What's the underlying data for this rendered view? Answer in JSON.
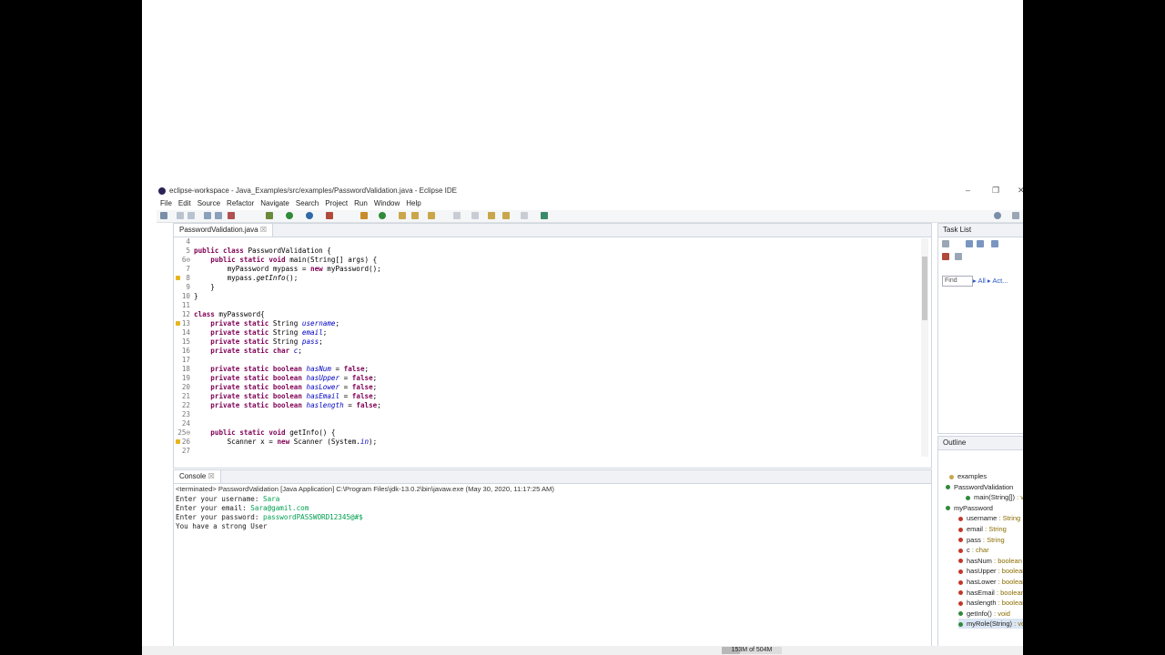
{
  "window": {
    "title": "eclipse-workspace - Java_Examples/src/examples/PasswordValidation.java - Eclipse IDE",
    "controls": [
      "–",
      "❐",
      "✕"
    ]
  },
  "menu": [
    "File",
    "Edit",
    "Source",
    "Refactor",
    "Navigate",
    "Search",
    "Project",
    "Run",
    "Window",
    "Help"
  ],
  "editor": {
    "tab_label": "PasswordValidation.java",
    "tab_close": "☒"
  },
  "console": {
    "tab_label": "Console",
    "tab_close": "☒",
    "status": "<terminated> PasswordValidation [Java Application] C:\\Program Files\\jdk-13.0.2\\bin\\javaw.exe (May 30, 2020, 11:17:25 AM)",
    "lines": [
      {
        "prompt": "Enter your username: ",
        "input": "Sara"
      },
      {
        "prompt": "Enter your email: ",
        "input": "Sara@gamil.com"
      },
      {
        "prompt": "Enter your password: ",
        "input": "passwordPASSWORD12345@#$"
      },
      {
        "prompt": "You have a strong User",
        "input": ""
      }
    ]
  },
  "tasklist": {
    "tab_label": "Task List",
    "find_placeholder": "Find",
    "link_all": "All",
    "link_activate": "Act..."
  },
  "outline": {
    "tab_label": "Outline",
    "items": [
      {
        "name": "examples",
        "type": ""
      },
      {
        "name": "PasswordValidation",
        "type": ""
      },
      {
        "name": "main(String[])",
        "type": " : void"
      },
      {
        "name": "myPassword",
        "type": ""
      },
      {
        "name": "username",
        "type": " : String"
      },
      {
        "name": "email",
        "type": " : String"
      },
      {
        "name": "pass",
        "type": " : String"
      },
      {
        "name": "c",
        "type": " : char"
      },
      {
        "name": "hasNum",
        "type": " : boolean"
      },
      {
        "name": "hasUpper",
        "type": " : boolean"
      },
      {
        "name": "hasLower",
        "type": " : boolean"
      },
      {
        "name": "hasEmail",
        "type": " : boolean"
      },
      {
        "name": "haslength",
        "type": " : boolean"
      },
      {
        "name": "getInfo()",
        "type": " : void"
      },
      {
        "name": "myRole(String)",
        "type": " : void"
      }
    ]
  },
  "status_bar": {
    "heap": "153M of 504M",
    "heap_used_fraction": 0.3
  },
  "code_lines": [
    {
      "n": "4",
      "t": ""
    },
    {
      "n": "5",
      "t": "public class PasswordValidation {"
    },
    {
      "n": "6⊖",
      "t": "    public static void main(String[] args) {"
    },
    {
      "n": "7",
      "t": "        myPassword mypass = new myPassword();"
    },
    {
      "n": "8",
      "t": "        mypass.getInfo();"
    },
    {
      "n": "9",
      "t": "    }"
    },
    {
      "n": "10",
      "t": "}"
    },
    {
      "n": "11",
      "t": ""
    },
    {
      "n": "12",
      "t": "class myPassword{"
    },
    {
      "n": "13",
      "t": "    private static String username;"
    },
    {
      "n": "14",
      "t": "    private static String email;"
    },
    {
      "n": "15",
      "t": "    private static String pass;"
    },
    {
      "n": "16",
      "t": "    private static char c;"
    },
    {
      "n": "17",
      "t": ""
    },
    {
      "n": "18",
      "t": "    private static boolean hasNum = false;"
    },
    {
      "n": "19",
      "t": "    private static boolean hasUpper = false;"
    },
    {
      "n": "20",
      "t": "    private static boolean hasLower = false;"
    },
    {
      "n": "21",
      "t": "    private static boolean hasEmail = false;"
    },
    {
      "n": "22",
      "t": "    private static boolean haslength = false;"
    },
    {
      "n": "23",
      "t": ""
    },
    {
      "n": "24",
      "t": ""
    },
    {
      "n": "25⊖",
      "t": "    public static void getInfo() {"
    },
    {
      "n": "26",
      "t": "        Scanner x = new Scanner (System.in);"
    },
    {
      "n": "27",
      "t": ""
    }
  ],
  "code_markers": [
    "8",
    "13",
    "26"
  ]
}
